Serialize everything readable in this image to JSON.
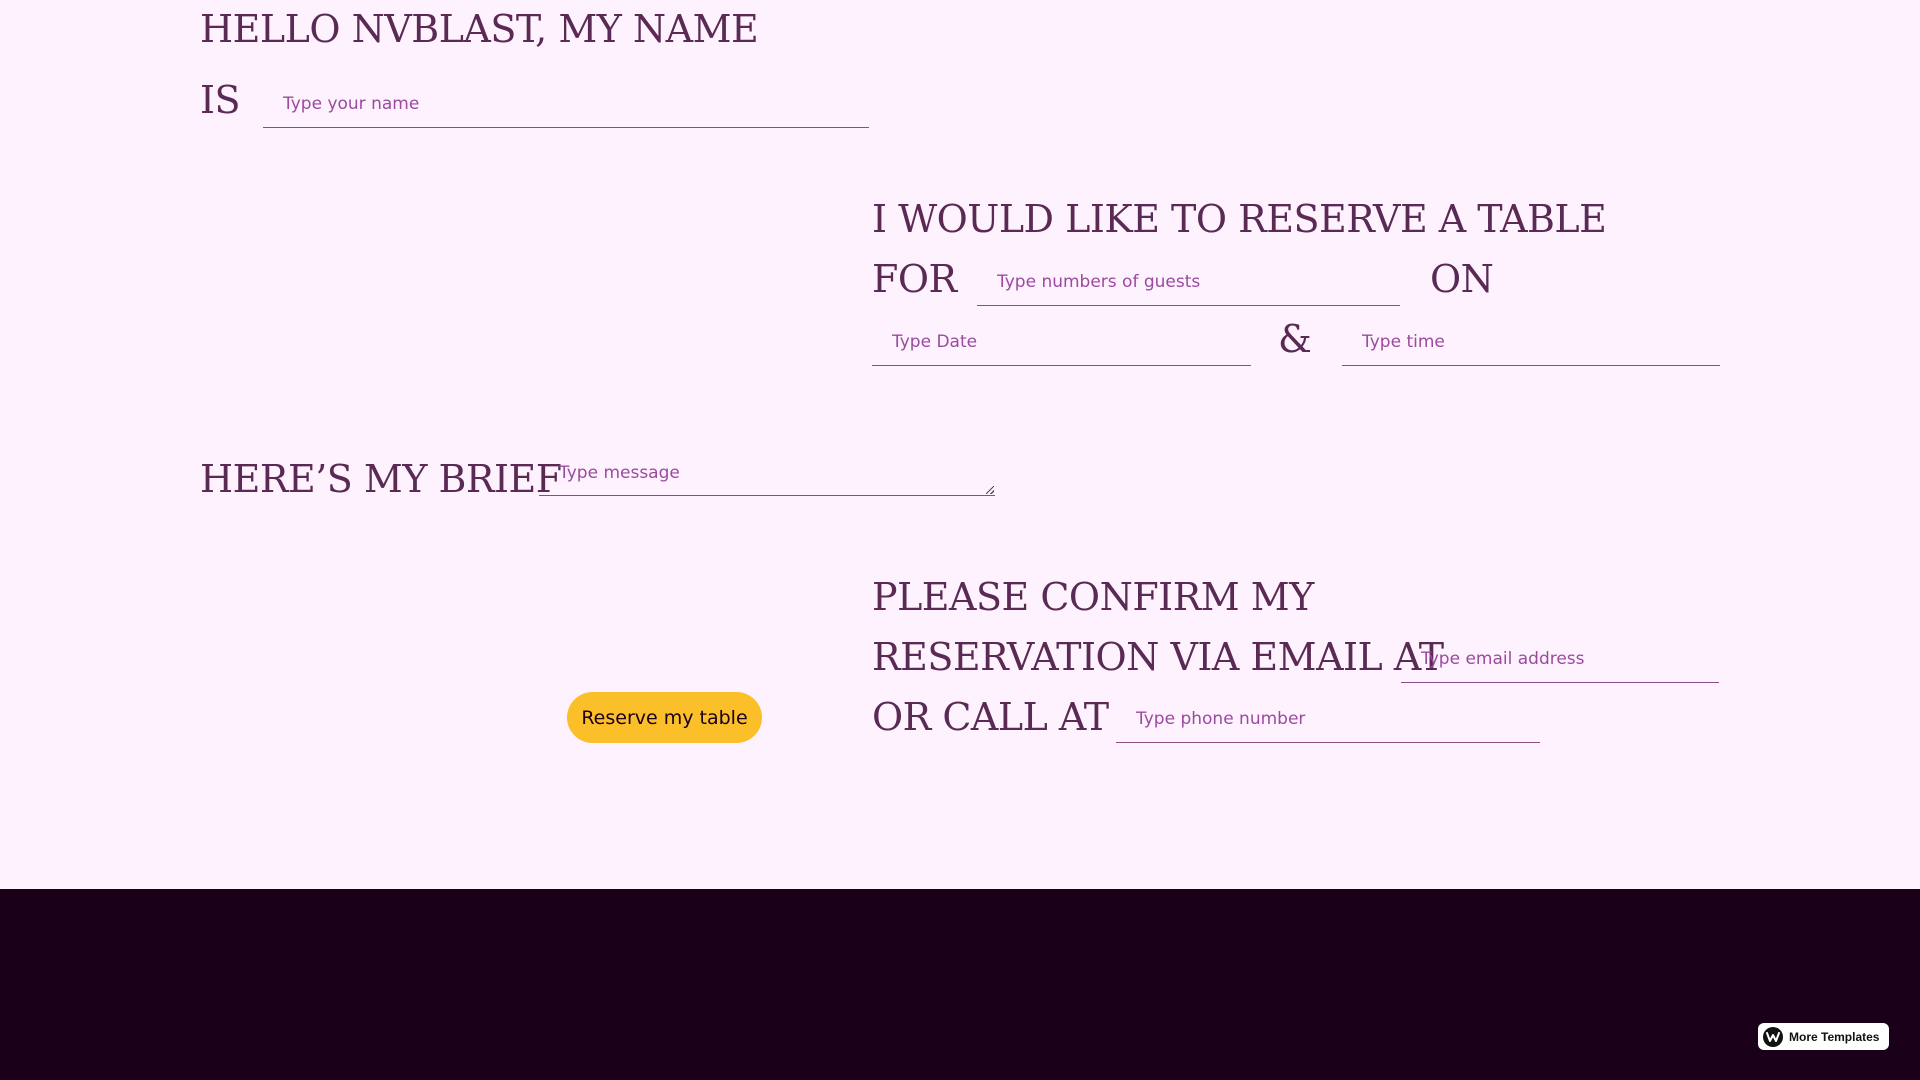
{
  "colors": {
    "background": "#fdf2fd",
    "heading": "#5a2a55",
    "placeholder": "#9b4aa0",
    "underline": "#8a4d86",
    "button_bg": "#fbbf2a",
    "footer_bg": "#1b0019"
  },
  "form": {
    "greeting_line1": "HELLO NVBLAST, MY NAME",
    "greeting_line2": "IS",
    "name_placeholder": "Type your name",
    "reserve_line1": "I WOULD LIKE TO RESERVE A TABLE",
    "reserve_for": "FOR",
    "guests_placeholder": "Type numbers of guests",
    "reserve_on": "ON",
    "date_placeholder": "Type Date",
    "ampersand": "&",
    "time_placeholder": "Type time",
    "brief_label": "HERE’S MY BRIEF",
    "message_placeholder": "Type message",
    "confirm_line1": "PLEASE CONFIRM MY",
    "confirm_line2": "RESERVATION VIA EMAIL AT",
    "email_placeholder": "Type email address",
    "confirm_line3": "OR CALL AT",
    "phone_placeholder": "Type phone number",
    "submit_label": "Reserve my table"
  },
  "badge": {
    "icon": "webflow-logo-icon",
    "label": "More Templates"
  }
}
